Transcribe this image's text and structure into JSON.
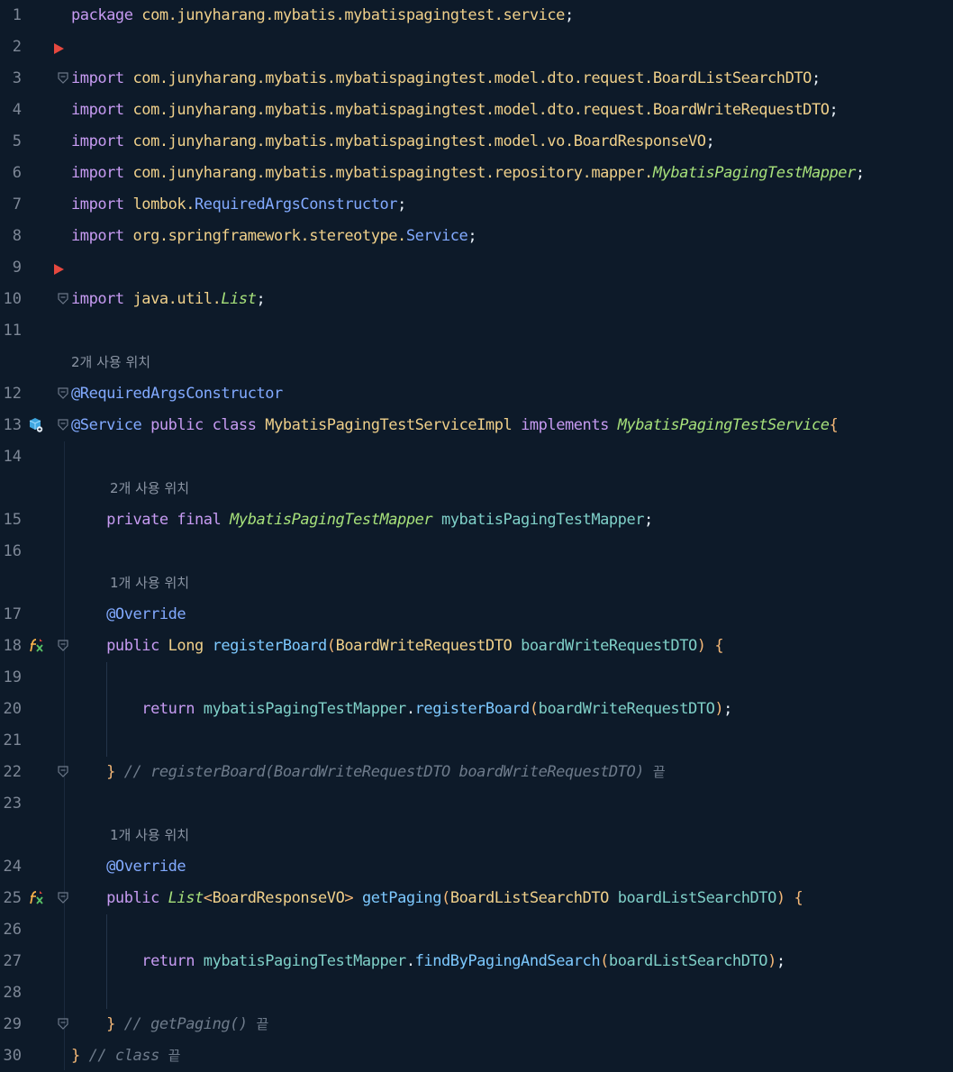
{
  "editor": {
    "lines": [
      {
        "n": "1",
        "segs": [
          [
            "kw",
            "package "
          ],
          [
            "pk",
            "com.junyharang.mybatis.mybatispagingtest.service"
          ],
          [
            "pn",
            ";"
          ]
        ]
      },
      {
        "n": "2",
        "segs": []
      },
      {
        "n": "3",
        "segs": [
          [
            "kw",
            "import "
          ],
          [
            "pk",
            "com.junyharang.mybatis.mybatispagingtest.model.dto.request."
          ],
          [
            "cls",
            "BoardListSearchDTO"
          ],
          [
            "pn",
            ";"
          ]
        ]
      },
      {
        "n": "4",
        "segs": [
          [
            "kw",
            "import "
          ],
          [
            "pk",
            "com.junyharang.mybatis.mybatispagingtest.model.dto.request."
          ],
          [
            "cls",
            "BoardWriteRequestDTO"
          ],
          [
            "pn",
            ";"
          ]
        ]
      },
      {
        "n": "5",
        "segs": [
          [
            "kw",
            "import "
          ],
          [
            "pk",
            "com.junyharang.mybatis.mybatispagingtest.model.vo."
          ],
          [
            "cls",
            "BoardResponseVO"
          ],
          [
            "pn",
            ";"
          ]
        ]
      },
      {
        "n": "6",
        "segs": [
          [
            "kw",
            "import "
          ],
          [
            "pk",
            "com.junyharang.mybatis.mybatispagingtest.repository.mapper."
          ],
          [
            "ital",
            "MybatisPagingTestMapper"
          ],
          [
            "pn",
            ";"
          ]
        ]
      },
      {
        "n": "7",
        "segs": [
          [
            "kw",
            "import "
          ],
          [
            "pk",
            "lombok."
          ],
          [
            "lib",
            "RequiredArgsConstructor"
          ],
          [
            "pn",
            ";"
          ]
        ]
      },
      {
        "n": "8",
        "segs": [
          [
            "kw",
            "import "
          ],
          [
            "pk",
            "org.springframework.stereotype."
          ],
          [
            "lib",
            "Service"
          ],
          [
            "pn",
            ";"
          ]
        ]
      },
      {
        "n": "9",
        "segs": []
      },
      {
        "n": "10",
        "segs": [
          [
            "kw",
            "import "
          ],
          [
            "pk",
            "java.util."
          ],
          [
            "ital",
            "List"
          ],
          [
            "pn",
            ";"
          ]
        ]
      },
      {
        "n": "11",
        "segs": []
      },
      {
        "hint": "2개 사용 위치",
        "indent": 0
      },
      {
        "n": "12",
        "segs": [
          [
            "ann",
            "@RequiredArgsConstructor"
          ]
        ]
      },
      {
        "n": "13",
        "segs": [
          [
            "ann",
            "@Service "
          ],
          [
            "kw",
            "public class "
          ],
          [
            "cls",
            "MybatisPagingTestServiceImpl "
          ],
          [
            "kw",
            "implements "
          ],
          [
            "ital",
            "MybatisPagingTestService"
          ],
          [
            "br",
            "{"
          ]
        ]
      },
      {
        "n": "14",
        "segs": []
      },
      {
        "hint": "2개 사용 위치",
        "indent": 1
      },
      {
        "n": "15",
        "segs": [
          [
            "pl",
            "    "
          ],
          [
            "kw",
            "private final "
          ],
          [
            "ital",
            "MybatisPagingTestMapper "
          ],
          [
            "fld",
            "mybatisPagingTestMapper"
          ],
          [
            "pn",
            ";"
          ]
        ]
      },
      {
        "n": "16",
        "segs": []
      },
      {
        "hint": "1개 사용 위치",
        "indent": 1
      },
      {
        "n": "17",
        "segs": [
          [
            "pl",
            "    "
          ],
          [
            "ann",
            "@Override"
          ]
        ]
      },
      {
        "n": "18",
        "segs": [
          [
            "pl",
            "    "
          ],
          [
            "kw",
            "public "
          ],
          [
            "cls",
            "Long "
          ],
          [
            "fn",
            "registerBoard"
          ],
          [
            "br",
            "("
          ],
          [
            "cls",
            "BoardWriteRequestDTO "
          ],
          [
            "fld",
            "boardWriteRequestDTO"
          ],
          [
            "br",
            ") {"
          ]
        ]
      },
      {
        "n": "19",
        "segs": []
      },
      {
        "n": "20",
        "segs": [
          [
            "pl",
            "        "
          ],
          [
            "kw",
            "return "
          ],
          [
            "fld",
            "mybatisPagingTestMapper"
          ],
          [
            "pn",
            "."
          ],
          [
            "fn",
            "registerBoard"
          ],
          [
            "br",
            "("
          ],
          [
            "fld",
            "boardWriteRequestDTO"
          ],
          [
            "br",
            ")"
          ],
          [
            "pn",
            ";"
          ]
        ]
      },
      {
        "n": "21",
        "segs": []
      },
      {
        "n": "22",
        "segs": [
          [
            "pl",
            "    "
          ],
          [
            "br",
            "} "
          ],
          [
            "cmt",
            "// registerBoard(BoardWriteRequestDTO boardWriteRequestDTO) "
          ],
          [
            "kcmt",
            "끝"
          ]
        ]
      },
      {
        "n": "23",
        "segs": []
      },
      {
        "hint": "1개 사용 위치",
        "indent": 1
      },
      {
        "n": "24",
        "segs": [
          [
            "pl",
            "    "
          ],
          [
            "ann",
            "@Override"
          ]
        ]
      },
      {
        "n": "25",
        "segs": [
          [
            "pl",
            "    "
          ],
          [
            "kw",
            "public "
          ],
          [
            "ital",
            "List"
          ],
          [
            "br",
            "<"
          ],
          [
            "cls",
            "BoardResponseVO"
          ],
          [
            "br",
            "> "
          ],
          [
            "fn",
            "getPaging"
          ],
          [
            "br",
            "("
          ],
          [
            "cls",
            "BoardListSearchDTO "
          ],
          [
            "fld",
            "boardListSearchDTO"
          ],
          [
            "br",
            ") {"
          ]
        ]
      },
      {
        "n": "26",
        "segs": []
      },
      {
        "n": "27",
        "segs": [
          [
            "pl",
            "        "
          ],
          [
            "kw",
            "return "
          ],
          [
            "fld",
            "mybatisPagingTestMapper"
          ],
          [
            "pn",
            "."
          ],
          [
            "fn",
            "findByPagingAndSearch"
          ],
          [
            "br",
            "("
          ],
          [
            "fld",
            "boardListSearchDTO"
          ],
          [
            "br",
            ")"
          ],
          [
            "pn",
            ";"
          ]
        ]
      },
      {
        "n": "28",
        "segs": []
      },
      {
        "n": "29",
        "segs": [
          [
            "pl",
            "    "
          ],
          [
            "br",
            "} "
          ],
          [
            "cmt",
            "// getPaging() "
          ],
          [
            "kcmt",
            "끝"
          ]
        ]
      },
      {
        "n": "30",
        "segs": [
          [
            "br",
            "} "
          ],
          [
            "cmt",
            "// class "
          ],
          [
            "kcmt",
            "끝"
          ]
        ]
      }
    ]
  },
  "gutter": {
    "breakpoint_marker_color": "#e5483f",
    "icons": {
      "13": "spring-bean-icon",
      "18": "implements-method-icon",
      "25": "implements-method-icon"
    },
    "folds": [
      "3",
      "10",
      "12",
      "13",
      "18",
      "22",
      "25",
      "29"
    ],
    "breakpoints_before": [
      "3",
      "10"
    ]
  },
  "theme": {
    "background": "#0d1a29",
    "keyword": "#c79bf2",
    "package": "#f0d08a",
    "italic_type": "#a6e07a",
    "annotation": "#82aaff",
    "field": "#7fd0c8",
    "method": "#7dc9ff",
    "comment": "#6e7b8b"
  }
}
